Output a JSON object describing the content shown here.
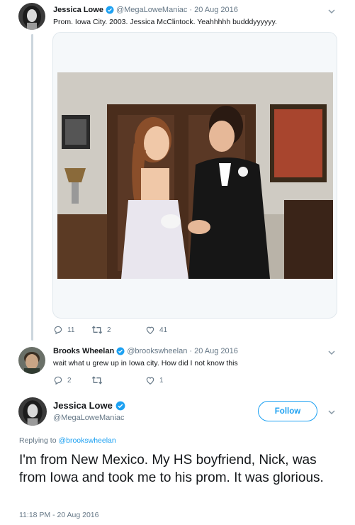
{
  "tweet1": {
    "name": "Jessica Lowe",
    "handle": "@MegaLoweManiac",
    "date": "· 20 Aug 2016",
    "text": "Prom. Iowa City. 2003. Jessica McClintock. Yeahhhhh budddyyyyyy.",
    "replies": "11",
    "retweets": "2",
    "likes": "41"
  },
  "tweet2": {
    "name": "Brooks Wheelan",
    "handle": "@brookswheelan",
    "date": "· 20 Aug 2016",
    "text": "wait what u grew up in Iowa city. How did I not know this",
    "replies": "2",
    "retweets": "",
    "likes": "1"
  },
  "main_tweet": {
    "name": "Jessica Lowe",
    "handle": "@MegaLoweManiac",
    "follow_label": "Follow",
    "replying_prefix": "Replying to",
    "replying_to": "@brookswheelan",
    "text": "I'm from New Mexico. My HS boyfriend, Nick, was from Iowa and took me to his prom. It was glorious.",
    "timestamp": "11:18 PM - 20 Aug 2016"
  },
  "colors": {
    "accent": "#1da1f2",
    "muted": "#657786",
    "text": "#14171a",
    "border": "#e1e8ed"
  },
  "icons": {
    "verified": "verified-badge-icon",
    "reply": "reply-icon",
    "retweet": "retweet-icon",
    "like": "heart-icon",
    "menu": "chevron-down-icon"
  }
}
